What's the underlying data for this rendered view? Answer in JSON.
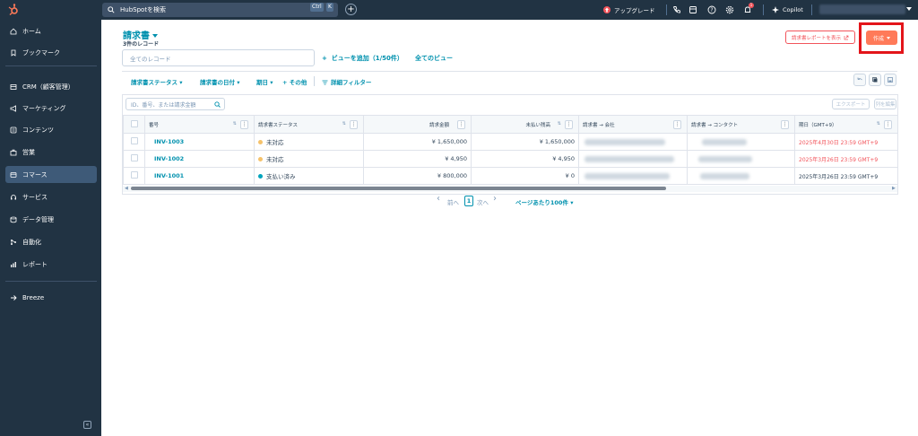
{
  "topbar": {
    "search_placeholder": "HubSpotを検索",
    "shortcut_ctrl": "Ctrl",
    "shortcut_key": "K",
    "upgrade_label": "アップグレード",
    "notification_count": "1",
    "copilot_label": "Copilot"
  },
  "sidebar": {
    "items": [
      {
        "label": "ホーム",
        "icon": "home-icon"
      },
      {
        "label": "ブックマーク",
        "icon": "bookmark-icon"
      },
      {
        "label": "CRM（顧客管理）",
        "icon": "crm-icon"
      },
      {
        "label": "マーケティング",
        "icon": "megaphone-icon"
      },
      {
        "label": "コンテンツ",
        "icon": "content-icon"
      },
      {
        "label": "営業",
        "icon": "sales-icon"
      },
      {
        "label": "コマース",
        "icon": "commerce-icon"
      },
      {
        "label": "サービス",
        "icon": "service-icon"
      },
      {
        "label": "データ管理",
        "icon": "database-icon"
      },
      {
        "label": "自動化",
        "icon": "automation-icon"
      },
      {
        "label": "レポート",
        "icon": "reports-icon"
      },
      {
        "label": "Breeze",
        "icon": "breeze-icon"
      }
    ],
    "active_item": "コマース"
  },
  "page": {
    "title": "請求書",
    "record_count": "3件のレコード",
    "report_button": "請求書レポートを表示",
    "create_button": "作成",
    "view_search_placeholder": "全てのレコード",
    "add_view": "ビューを追加（1/50件）",
    "all_views": "全てのビュー"
  },
  "filters": {
    "status": "請求書ステータス",
    "date": "請求書の日付",
    "due": "期日",
    "more": "その他",
    "advanced": "詳細フィルター"
  },
  "table": {
    "search_placeholder": "ID、番号、または請求金額",
    "export_button": "エクスポート",
    "edit_columns_button": "列を編集",
    "columns": [
      "番号",
      "請求書ステータス",
      "請求金額",
      "未払い残高",
      "請求書 → 会社",
      "請求書 → コンタクト",
      "期日（GMT+9）"
    ],
    "rows": [
      {
        "number": "INV-1003",
        "status": "未対応",
        "status_color": "#f5c26b",
        "amount": "¥ 1,650,000",
        "balance": "¥ 1,650,000",
        "due": "2025年4月30日 23:59 GMT+9",
        "due_overdue": true
      },
      {
        "number": "INV-1002",
        "status": "未対応",
        "status_color": "#f5c26b",
        "amount": "¥ 4,950",
        "balance": "¥ 4,950",
        "due": "2025年3月26日 23:59 GMT+9",
        "due_overdue": true
      },
      {
        "number": "INV-1001",
        "status": "支払い済み",
        "status_color": "#00a4bd",
        "amount": "¥ 800,000",
        "balance": "¥ 0",
        "due": "2025年3月26日 23:59 GMT+9",
        "due_overdue": false
      }
    ]
  },
  "pagination": {
    "prev": "前へ",
    "page": "1",
    "next": "次へ",
    "per_page": "ページあたり100件"
  }
}
